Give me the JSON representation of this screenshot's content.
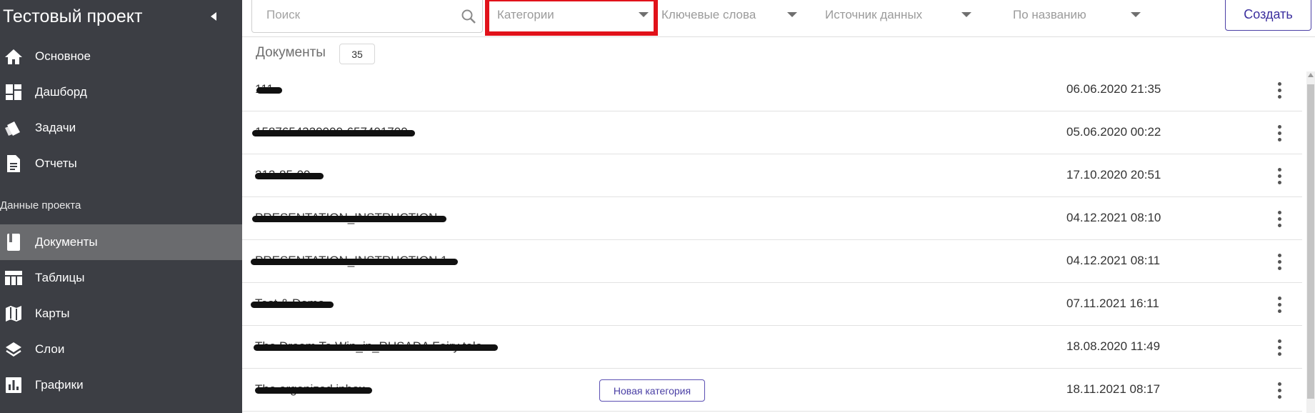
{
  "sidebar": {
    "title": "Тестовый проект",
    "main_items": [
      {
        "label": "Основное",
        "icon": "home-icon"
      },
      {
        "label": "Дашборд",
        "icon": "dashboard-icon"
      },
      {
        "label": "Задачи",
        "icon": "tasks-icon"
      },
      {
        "label": "Отчеты",
        "icon": "report-icon"
      }
    ],
    "section_title": "Данные проекта",
    "data_items": [
      {
        "label": "Документы",
        "icon": "document-icon",
        "active": true
      },
      {
        "label": "Таблицы",
        "icon": "table-icon"
      },
      {
        "label": "Карты",
        "icon": "map-icon"
      },
      {
        "label": "Слои",
        "icon": "layers-icon"
      },
      {
        "label": "Графики",
        "icon": "chart-icon"
      }
    ]
  },
  "toolbar": {
    "search_placeholder": "Поиск",
    "filters": [
      "Категории",
      "Ключевые слова",
      "Источник данных",
      "По названию"
    ],
    "create_label": "Создать"
  },
  "documents": {
    "title": "Документы",
    "count": "35",
    "rows": [
      {
        "name": "111",
        "date": "06.06.2020 21:35"
      },
      {
        "name": "1587654320000-657401700",
        "date": "05.06.2020 00:22"
      },
      {
        "name": "212-85-09",
        "date": "17.10.2020 20:51"
      },
      {
        "name": "PRESENTATION_INSTRUCTION",
        "date": "04.12.2021 08:10"
      },
      {
        "name": "PRESENTATION_INSTRUCTION 1",
        "date": "04.12.2021 08:11"
      },
      {
        "name": "Test & Demo",
        "date": "07.11.2021 16:11"
      },
      {
        "name": "The Dream To Win_in_RUSADA Fairy tale",
        "date": "18.08.2020 11:49"
      },
      {
        "name": "The organized inbox",
        "date": "18.11.2021 08:17",
        "category": "Новая категория"
      }
    ]
  },
  "colors": {
    "sidebar_bg": "#3c3e44",
    "sidebar_active": "#6a6b6e",
    "accent": "#4a3fa5",
    "highlight": "#e1121a"
  }
}
